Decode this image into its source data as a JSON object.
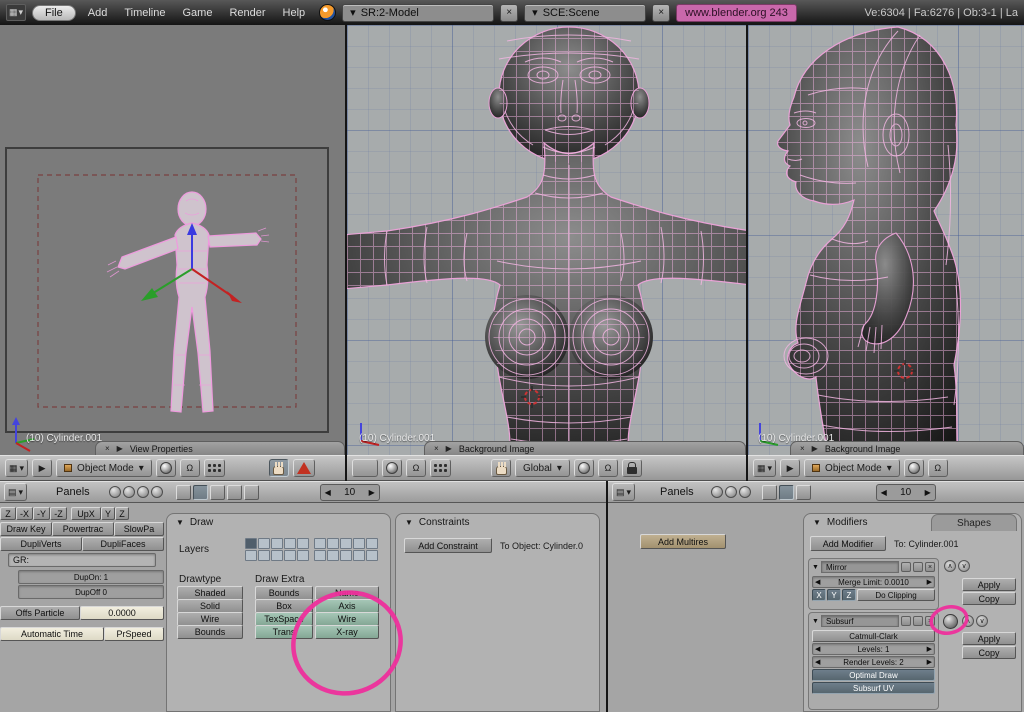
{
  "colors": {
    "annotation": "#ee2f9c",
    "link_bg": "#c968ab",
    "toggle_teal": "#8fb7a5",
    "toggle_dark": "#64747f",
    "multires_tan": "#b3a382"
  },
  "icons": {
    "grid": "▦",
    "list": "▤",
    "caret": "▾",
    "tri_down": "▼",
    "tri_right": "▶",
    "tri_left": "◀",
    "close": "×",
    "pivot": "Ω",
    "up": "∧",
    "down": "∨"
  },
  "topbar": {
    "menus": [
      "File",
      "Add",
      "Timeline",
      "Game",
      "Render",
      "Help"
    ],
    "screen": "SR:2-Model",
    "scene": "SCE:Scene",
    "link": "www.blender.org 243",
    "stats": "Ve:6304 | Fa:6276 | Ob:3-1 | La"
  },
  "viewports": {
    "left": {
      "label": "(10) Cylinder.001",
      "tab": "View Properties"
    },
    "middle": {
      "label": "(10) Cylinder.001",
      "tab": "Background Image"
    },
    "right": {
      "label": "(10) Cylinder.001",
      "tab": "Background Image"
    }
  },
  "viewport_headers": {
    "left_mode": "Object Mode",
    "middle_space": "Global",
    "right_mode": "Object Mode"
  },
  "buttons_header": {
    "panels": "Panels",
    "frame": "10"
  },
  "object_buttons": {
    "track": [
      "Z",
      "-X",
      "-Y",
      "-Z"
    ],
    "up": [
      "UpX",
      "Y",
      "Z"
    ],
    "anim": [
      "Draw Key",
      "Powertrac",
      "SlowPa"
    ],
    "dupli": [
      "DupliVerts",
      "DupliFaces"
    ],
    "group": "GR:",
    "dup_on": "DupOn: 1",
    "dup_off": "DupOff 0",
    "offs_particle": "Offs Particle",
    "offs_value": "0.0000",
    "auto_time": "Automatic Time",
    "pr_speed": "PrSpeed"
  },
  "draw_panel": {
    "title": "Draw",
    "layers_label": "Layers",
    "drawtype_label": "Drawtype",
    "drawtype": [
      "Shaded",
      "Solid",
      "Wire",
      "Bounds"
    ],
    "extra_label": "Draw Extra",
    "extra_col1": [
      "Bounds",
      "Box",
      "TexSpace",
      "Trans"
    ],
    "extra_col2": [
      "Name",
      "Axis",
      "Wire",
      "X-ray"
    ]
  },
  "constraints_panel": {
    "title": "Constraints",
    "add_button": "Add Constraint",
    "target": "To Object: Cylinder.0"
  },
  "multires_button": "Add Multires",
  "modifiers_panel": {
    "title": "Modifiers",
    "shapes_tab": "Shapes",
    "add_button": "Add Modifier",
    "target": "To: Cylinder.001",
    "mirror": {
      "name": "Mirror",
      "merge_limit": "Merge Limit: 0.0010",
      "axes": [
        "X",
        "Y",
        "Z"
      ],
      "clipping": "Do Clipping",
      "apply": "Apply",
      "copy": "Copy"
    },
    "subsurf": {
      "name": "Subsurf",
      "type": "Catmull-Clark",
      "levels": "Levels: 1",
      "render_levels": "Render Levels: 2",
      "optimal": "Optimal Draw",
      "uv": "Subsurf UV",
      "apply": "Apply",
      "copy": "Copy"
    }
  }
}
